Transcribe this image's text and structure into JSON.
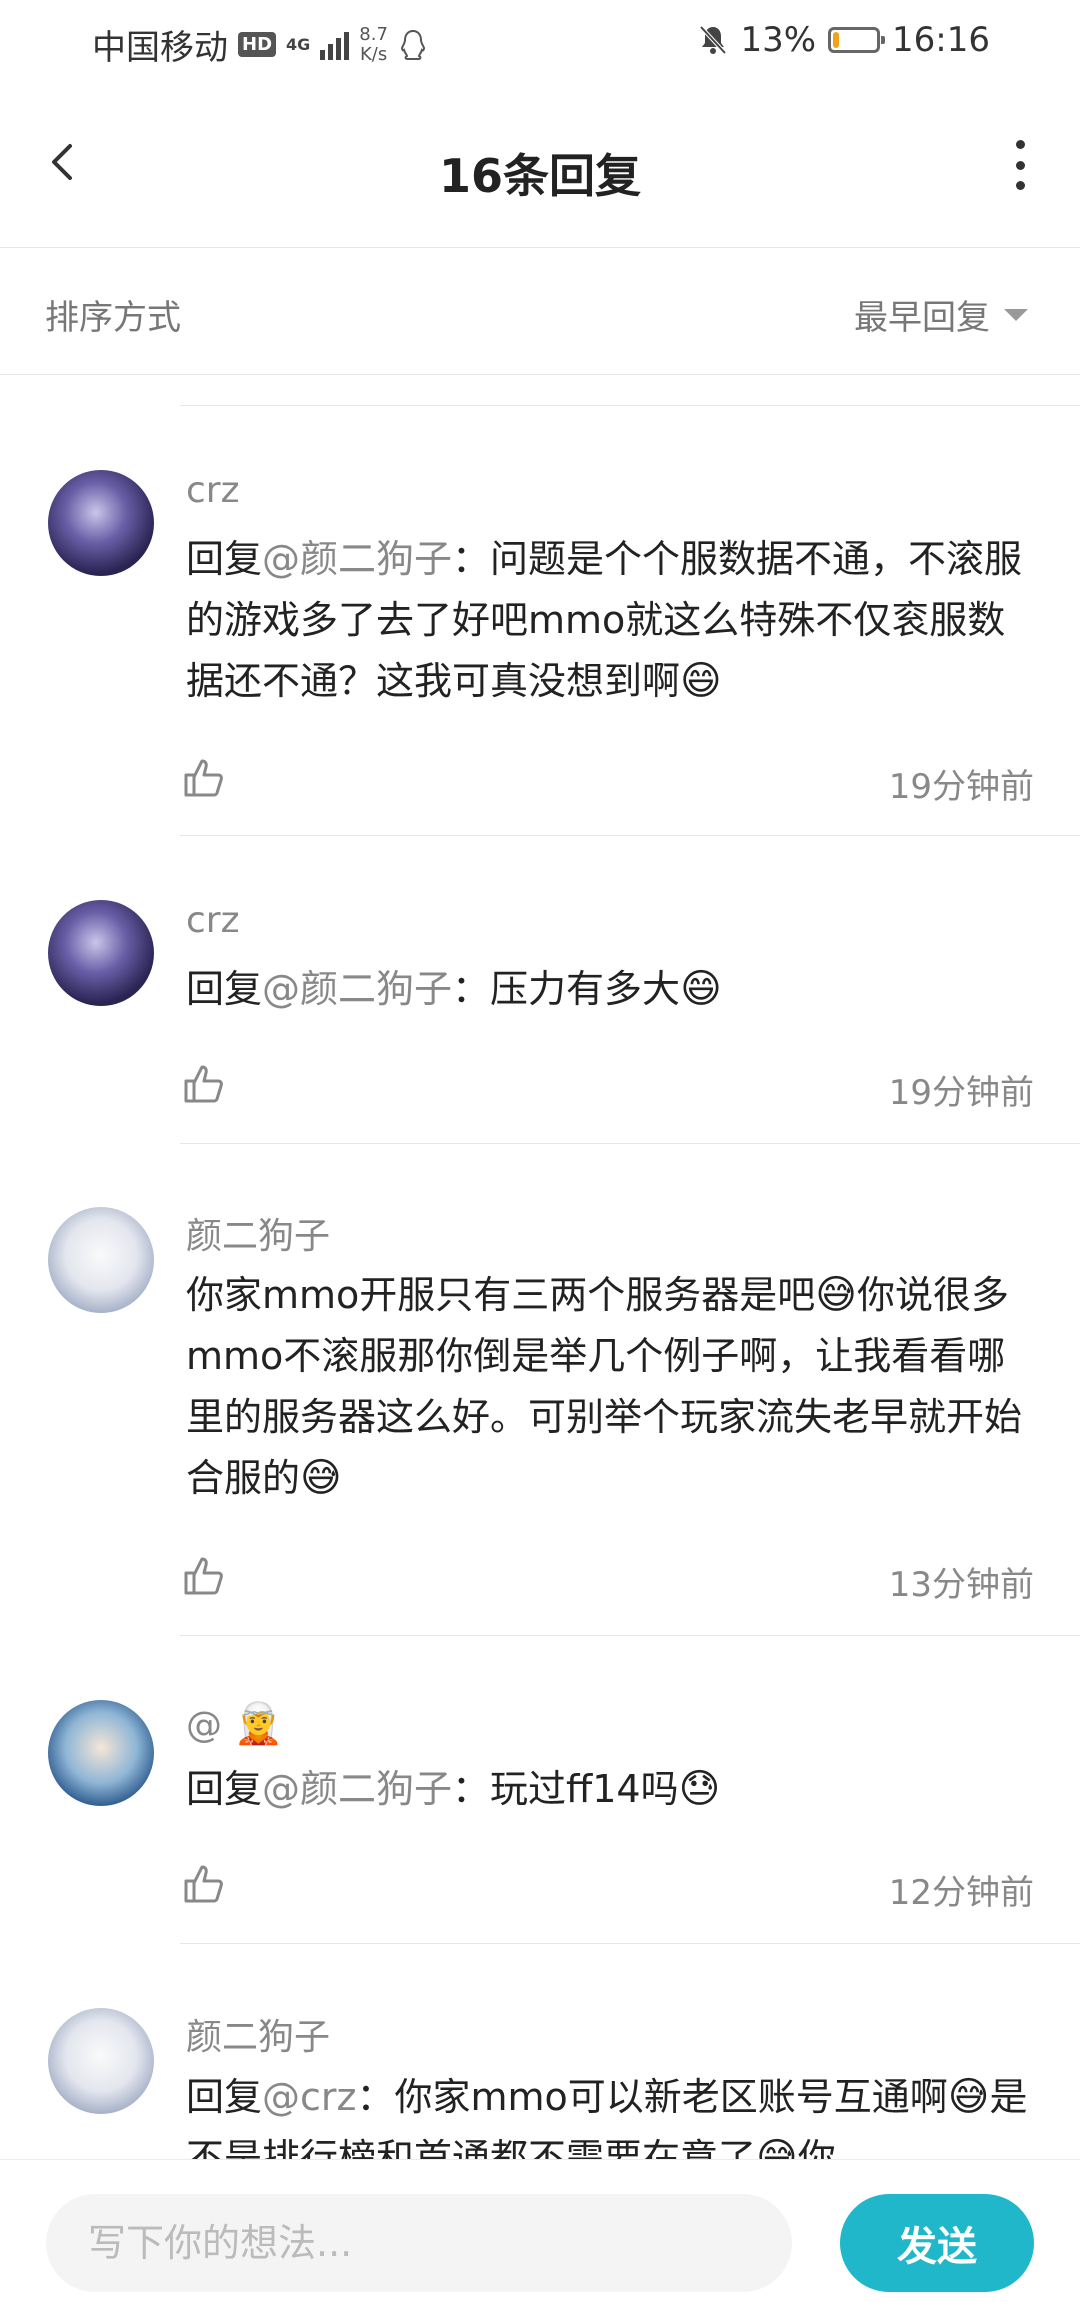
{
  "status_bar": {
    "carrier": "中国移动",
    "hd": "HD",
    "network": "4G",
    "speed_value": "8.7",
    "speed_unit": "K/s",
    "battery": "13%",
    "battery_level": 0.13,
    "time": "16:16"
  },
  "header": {
    "title": "16条回复"
  },
  "sort": {
    "label": "排序方式",
    "value": "最早回复"
  },
  "comments": [
    {
      "username": "crz",
      "prefix": "回复",
      "mention": "@颜二狗子",
      "sep": "：",
      "body": "问题是个个服数据不通，不滚服的游戏多了去了好吧mmo就这么特殊不仅衮服数据还不通？这我可真没想到啊",
      "emoji": "😄",
      "time": "19分钟前"
    },
    {
      "username": "crz",
      "prefix": "回复",
      "mention": "@颜二狗子",
      "sep": "：",
      "body": "压力有多大",
      "emoji": "😄",
      "time": "19分钟前"
    },
    {
      "username": "颜二狗子",
      "part1": "你家mmo开服只有三两个服务器是吧",
      "emoji1": "😅",
      "part2": "你说很多mmo不滚服那你倒是举几个例子啊，让我看看哪里的服务器这么好。可别举个玩家流失老早就开始合服的",
      "emoji2": "😅",
      "time": "13分钟前"
    },
    {
      "username": "@",
      "username_emoji": "🧝",
      "prefix": "回复",
      "mention": "@颜二狗子",
      "sep": "：",
      "body": "玩过ff14吗",
      "emoji": "😓",
      "time": "12分钟前"
    },
    {
      "username": "颜二狗子",
      "prefix": "回复",
      "mention": "@crz",
      "sep": "：",
      "body": "你家mmo可以新老区账号互通啊",
      "emoji": "😅",
      "body2": "是不是排行榜和首通都不需要在意了",
      "emoji2": "😅",
      "body3": "你"
    }
  ],
  "composer": {
    "placeholder": "写下你的想法...",
    "send_label": "发送"
  },
  "icons": {
    "back": "chevron-left-icon",
    "more": "more-vertical-icon",
    "like": "thumbs-up-icon",
    "mute": "bell-off-icon",
    "qq": "qq-penguin-icon"
  },
  "colors": {
    "accent": "#1fb7c9",
    "battery_low": "#f3a21a"
  }
}
